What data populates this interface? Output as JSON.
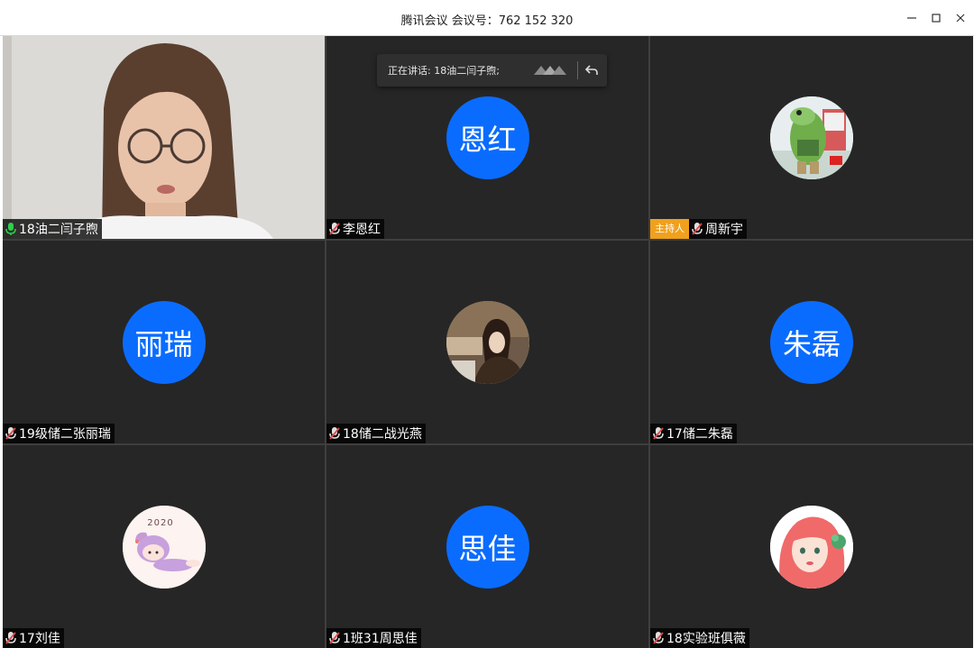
{
  "window": {
    "title": "腾讯会议 会议号：762 152 320",
    "minimize_icon": "minimize-icon",
    "maximize_icon": "maximize-icon",
    "close_icon": "close-icon"
  },
  "speaking": {
    "text": "正在讲话: 18油二闫子煦;"
  },
  "colors": {
    "avatar_blue": "#0a6cff",
    "host_badge": "#f0a01c",
    "tile_bg": "#262626",
    "mic_active": "#2bd14a",
    "mic_muted": "#e04a4a"
  },
  "participants": [
    {
      "name": "18油二闫子煦",
      "mic": "active",
      "avatar_type": "video"
    },
    {
      "name": "李恩红",
      "mic": "muted",
      "avatar_type": "text",
      "avatar_text": "恩红"
    },
    {
      "name": "周新宇",
      "mic": "muted",
      "avatar_type": "image",
      "avatar_icon": "cartoon-frog-avatar",
      "host": true,
      "host_label": "主持人"
    },
    {
      "name": "19级储二张丽瑞",
      "mic": "muted",
      "avatar_type": "text",
      "avatar_text": "丽瑞"
    },
    {
      "name": "18储二战光燕",
      "mic": "muted",
      "avatar_type": "image",
      "avatar_icon": "photo-avatar"
    },
    {
      "name": "17储二朱磊",
      "mic": "muted",
      "avatar_type": "text",
      "avatar_text": "朱磊"
    },
    {
      "name": "17刘佳",
      "mic": "muted",
      "avatar_type": "image",
      "avatar_icon": "cartoon-girl-2020-avatar",
      "avatar_caption": "2020"
    },
    {
      "name": "1班31周思佳",
      "mic": "muted",
      "avatar_type": "text",
      "avatar_text": "思佳"
    },
    {
      "name": "18实验班俱薇",
      "mic": "muted",
      "avatar_type": "image",
      "avatar_icon": "cartoon-redhair-girl-avatar"
    }
  ]
}
